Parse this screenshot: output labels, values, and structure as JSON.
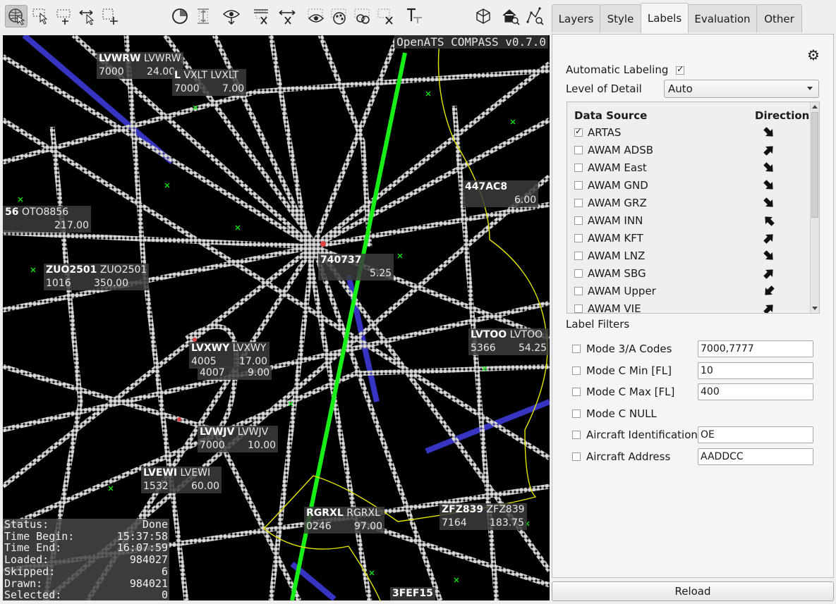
{
  "toolbar": {
    "tools": [
      "navigate-icon",
      "select-point-icon",
      "add-rect-icon",
      "move-select-icon",
      "select-rect-icon",
      "time-icon",
      "distance-icon",
      "show-icon",
      "clear-icon",
      "measure-icon",
      "eye-icon",
      "palette-icon",
      "filter-icon",
      "remove-icon",
      "text-icon",
      "grid3d-icon",
      "home-icon",
      "zoom-icon"
    ]
  },
  "map": {
    "version": "OpenATS COMPASS v0.7.0",
    "labels": [
      {
        "id": "lvwrw",
        "line1_bold": "LVWRW",
        "line1": "LVWRW",
        "line2a": "7000",
        "line2b": "24.00"
      },
      {
        "id": "lvxlt",
        "line1_bold": "L",
        "line1": "VXLT LVXLT",
        "line2a": "7000",
        "line2b": "7.00"
      },
      {
        "id": "oto8856",
        "line1_bold": "56",
        "line1": "OTO8856",
        "line2a": "",
        "line2b": "217.00"
      },
      {
        "id": "zuo2501",
        "line1_bold": "ZUO2501",
        "line1": "ZUO2501",
        "line2a": "1016",
        "line2b": "350.00"
      },
      {
        "id": "740737",
        "line1_bold": "740737",
        "line1": "",
        "line2a": "",
        "line2b": "5.25"
      },
      {
        "id": "447ac8",
        "line1_bold": "447AC8",
        "line1": "",
        "line2a": "",
        "line2b": "6.00"
      },
      {
        "id": "lvtoo",
        "line1_bold": "LVTOO",
        "line1": "LVTOO",
        "line2a": "5366",
        "line2b": "54.25"
      },
      {
        "id": "lvxwy",
        "line1_bold": "LVXWY",
        "line1": "LVXWY",
        "line2a": "4005",
        "line2b": "17.00"
      },
      {
        "id": "4007",
        "line1_bold": "",
        "line1": "",
        "line2a": "4007",
        "line2b": "9.00"
      },
      {
        "id": "lvwjv",
        "line1_bold": "LVWJV",
        "line1": "LVWJV",
        "line2a": "7000",
        "line2b": "10.00"
      },
      {
        "id": "lvewi",
        "line1_bold": "LVEWI",
        "line1": "LVEWI",
        "line2a": "1532",
        "line2b": "60.00"
      },
      {
        "id": "rgrxl",
        "line1_bold": "RGRXL",
        "line1": "RGRXL",
        "line2a": "0246",
        "line2b": "97.00"
      },
      {
        "id": "zfz839",
        "line1_bold": "ZFZ839",
        "line1": "ZFZ839",
        "line2a": "7164",
        "line2b": "183.75"
      },
      {
        "id": "3fef15",
        "line1_bold": "3FEF15",
        "line1": "",
        "line2a": "",
        "line2b": ""
      }
    ],
    "status": [
      {
        "k": "Status:",
        "v": "Done"
      },
      {
        "k": "Time Begin:",
        "v": "15:37:58"
      },
      {
        "k": "Time End:",
        "v": "16:07:59"
      },
      {
        "k": "Loaded:",
        "v": "984027"
      },
      {
        "k": "Skipped:",
        "v": "6"
      },
      {
        "k": "Drawn:",
        "v": "984021"
      },
      {
        "k": "Selected:",
        "v": "0"
      }
    ]
  },
  "tabs": [
    "Layers",
    "Style",
    "Labels",
    "Evaluation",
    "Other"
  ],
  "labels_tab": {
    "automatic_labeling": "Automatic Labeling",
    "level_of_detail": "Level of Detail",
    "level_value": "Auto",
    "data_source_header": "Data Source",
    "direction_header": "Direction",
    "sources": [
      {
        "name": "ARTAS",
        "checked": true,
        "dir": 135
      },
      {
        "name": "AWAM ADSB",
        "checked": false,
        "dir": 45
      },
      {
        "name": "AWAM East",
        "checked": false,
        "dir": 135
      },
      {
        "name": "AWAM GND",
        "checked": false,
        "dir": 135
      },
      {
        "name": "AWAM GRZ",
        "checked": false,
        "dir": 135
      },
      {
        "name": "AWAM INN",
        "checked": false,
        "dir": -45
      },
      {
        "name": "AWAM KFT",
        "checked": false,
        "dir": 45
      },
      {
        "name": "AWAM LNZ",
        "checked": false,
        "dir": 135
      },
      {
        "name": "AWAM SBG",
        "checked": false,
        "dir": 45
      },
      {
        "name": "AWAM Upper",
        "checked": false,
        "dir": -135
      },
      {
        "name": "AWAM VIE",
        "checked": false,
        "dir": 45
      }
    ],
    "label_filters": "Label Filters",
    "filters": [
      {
        "name": "Mode 3/A Codes",
        "value": "7000,7777"
      },
      {
        "name": "Mode C Min [FL]",
        "value": "10"
      },
      {
        "name": "Mode C Max [FL]",
        "value": "400"
      },
      {
        "name": "Mode C NULL",
        "value": null
      },
      {
        "name": "Aircraft Identification",
        "value": "OE"
      },
      {
        "name": "Aircraft Address",
        "value": "AADDCC"
      }
    ],
    "reload": "Reload"
  }
}
